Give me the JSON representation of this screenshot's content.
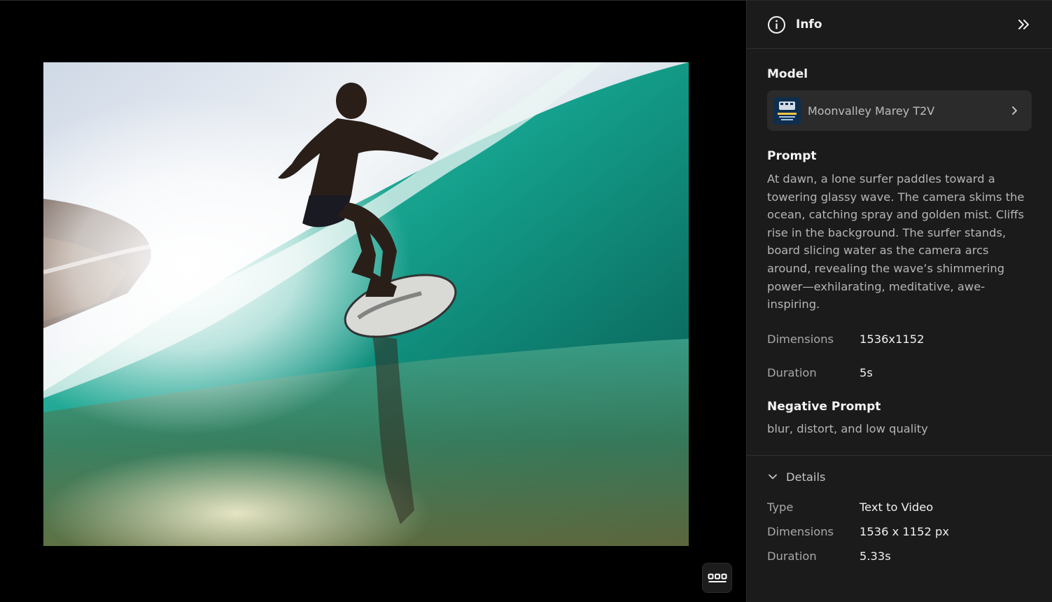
{
  "panel": {
    "title": "Info",
    "model_section_title": "Model",
    "model_name": "Moonvalley Marey T2V",
    "model_thumb_text": "MOONVALLEY MAREY",
    "prompt_title": "Prompt",
    "prompt_text": "At dawn, a lone surfer paddles toward a towering glassy wave. The camera skims the ocean, catching spray and golden mist. Cliffs rise in the background. The surfer stands, board slicing water as the camera arcs around, revealing the wave’s shimmering power—exhilarating, meditative, awe-inspiring.",
    "dimensions_label": "Dimensions",
    "dimensions_value": "1536x1152",
    "duration_label": "Duration",
    "duration_value": "5s",
    "negative_prompt_title": "Negative Prompt",
    "negative_prompt_text": "blur, distort, and low quality",
    "details_label": "Details",
    "details": [
      {
        "label": "Type",
        "value": "Text to Video"
      },
      {
        "label": "Dimensions",
        "value": "1536 x 1152 px"
      },
      {
        "label": "Duration",
        "value": "5.33s"
      }
    ]
  },
  "icons": {
    "info": "info-circle-icon",
    "collapse": "double-chevron-right-icon",
    "model_chevron": "chevron-right-icon",
    "details_chevron": "chevron-down-icon",
    "more": "more-dots-icon"
  },
  "colors": {
    "panel_bg": "#1b1b1b",
    "card_bg": "#2b2b2b",
    "viewer_bg": "#000000",
    "water": "#1f9e8c"
  }
}
